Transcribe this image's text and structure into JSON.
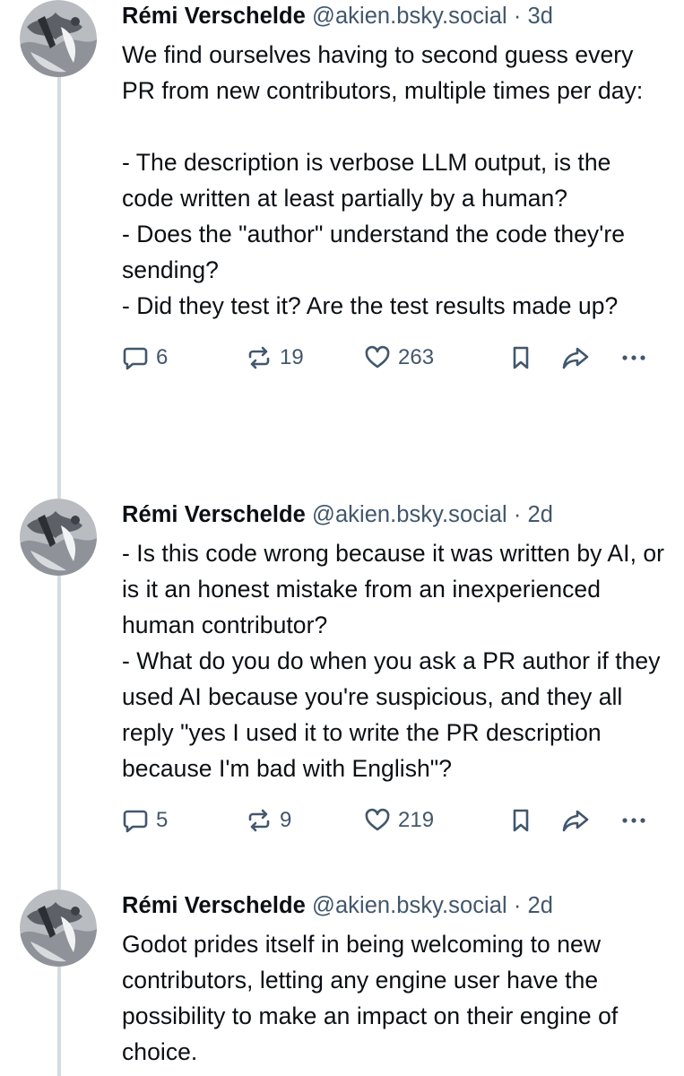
{
  "posts": [
    {
      "author": "Rémi Verschelde",
      "handle": "@akien.bsky.social",
      "separator": "·",
      "age": "3d",
      "text": "We find ourselves having to second guess every PR from new contributors, multiple times per day:\n\n- The description is verbose LLM output, is the code written at least partially by a human?\n- Does the \"author\" understand the code they're sending?\n- Did they test it? Are the test results made up?",
      "replies": "6",
      "reposts": "19",
      "likes": "263"
    },
    {
      "author": "Rémi Verschelde",
      "handle": "@akien.bsky.social",
      "separator": "·",
      "age": "2d",
      "text": "- Is this code wrong because it was written by AI, or is it an honest mistake from an inexperienced human contributor?\n- What do you do when you ask a PR author if they used AI because you're suspicious, and they all reply \"yes I used it to write the PR description because I'm bad with English\"?",
      "replies": "5",
      "reposts": "9",
      "likes": "219"
    },
    {
      "author": "Rémi Verschelde",
      "handle": "@akien.bsky.social",
      "separator": "·",
      "age": "2d",
      "text": "Godot prides itself in being welcoming to new contributors, letting any engine user have the possibility to make an impact on their engine of choice."
    }
  ],
  "icons": {
    "avatar": "avatar-photo",
    "reply": "reply-icon",
    "repost": "repost-icon",
    "like": "heart-icon",
    "bookmark": "bookmark-icon",
    "share": "share-icon",
    "more": "more-icon"
  },
  "colors": {
    "text": "#0b0f14",
    "muted": "#42576c",
    "thread_line": "#d4dbe2",
    "background": "#ffffff"
  }
}
